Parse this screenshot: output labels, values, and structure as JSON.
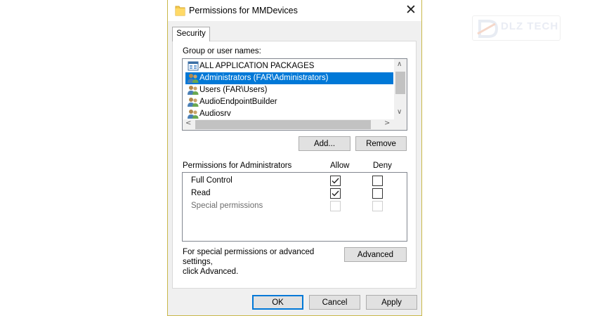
{
  "window": {
    "title": "Permissions for MMDevices",
    "close_glyph": "✕"
  },
  "tab": {
    "label": "Security"
  },
  "groups": {
    "label": "Group or user names:",
    "items": [
      {
        "label": "ALL APPLICATION PACKAGES",
        "icon": "package-icon",
        "selected": false
      },
      {
        "label": "Administrators (FAR\\Administrators)",
        "icon": "users-icon",
        "selected": true
      },
      {
        "label": "Users (FAR\\Users)",
        "icon": "users-icon",
        "selected": false
      },
      {
        "label": "AudioEndpointBuilder",
        "icon": "users-icon",
        "selected": false
      },
      {
        "label": "Audiosrv",
        "icon": "users-icon",
        "selected": false
      }
    ],
    "add_label": "Add...",
    "remove_label": "Remove"
  },
  "permissions": {
    "label": "Permissions for Administrators",
    "allow_header": "Allow",
    "deny_header": "Deny",
    "rows": [
      {
        "label": "Full Control",
        "allow": true,
        "deny": false,
        "disabled": false
      },
      {
        "label": "Read",
        "allow": true,
        "deny": false,
        "disabled": false
      },
      {
        "label": "Special permissions",
        "allow": false,
        "deny": false,
        "disabled": true
      }
    ]
  },
  "advanced": {
    "note_line1": "For special permissions or advanced settings,",
    "note_line2": "click Advanced.",
    "button_label": "Advanced"
  },
  "footer": {
    "ok_label": "OK",
    "cancel_label": "Cancel",
    "apply_label": "Apply"
  },
  "watermark": {
    "text": "DLZ TECH"
  },
  "colors": {
    "selection": "#0078d7",
    "dialog_bg": "#f0f0f0",
    "window_border": "#c9b84a",
    "folder": "#f3c94e"
  }
}
